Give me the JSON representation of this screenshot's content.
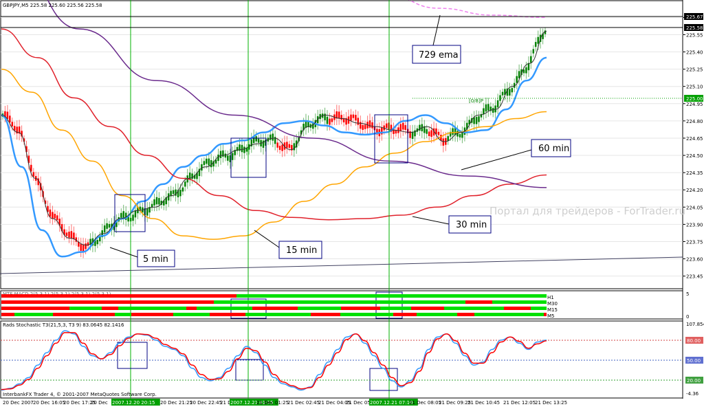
{
  "main": {
    "header": "GBPJPY,M5  225.58 225.60 225.56 225.58",
    "watermark": "Портал для трейдеров - ForTrader.ru",
    "price_ticks": [
      "225.70",
      "225.55",
      "225.40",
      "225.25",
      "225.10",
      "224.95",
      "224.80",
      "224.65",
      "224.50",
      "224.35",
      "224.20",
      "224.05",
      "223.90",
      "223.75",
      "223.60",
      "223.45"
    ],
    "tags": [
      "225.67",
      "225.58",
      "225.00"
    ],
    "level_label": "[0/8]P",
    "annotations": [
      "729 ema",
      "60 min",
      "30 min",
      "15 min",
      "5 min"
    ]
  },
  "mtf": {
    "header": "MTF MACD 2(5,3,1) 2(5,3,1) 2(5,3,1) 2(5,3,1)",
    "row_labels": [
      "H1",
      "M30",
      "M15",
      "M5"
    ],
    "scale_top": "5",
    "scale_bottom": "0"
  },
  "stoch": {
    "header": "Rads Stochastic T3(21,5,3, T3 9) 83.0645 82.1416",
    "levels": [
      "107.8544",
      "80.00",
      "50.00",
      "20.00",
      "-4.36"
    ]
  },
  "footer": "InterbankFX Trader 4, © 2001-2007 MetaQuotes Software Corp.",
  "time_axis": [
    "20 Dec 2007",
    "20 Dec 16:05",
    "20 Dec 17:25",
    "20 Dec",
    "2007.12.20 20:15",
    "20 Dec 21:25",
    "20 Dec 22:45",
    "21 Dec",
    "2007.12.21 01:15",
    "21 Dec 01:25",
    "21 Dec 02:45",
    "21 Dec 04:05",
    "21 Dec 05:..",
    "2007.12.21 07:10",
    "21 Dec 08:05",
    "21 Dec 09:25",
    "21 Dec 10:45",
    "21 Dec 12:05",
    "21 Dec 13:25"
  ],
  "colors": {
    "up": "#008000",
    "down": "#ff0000",
    "ema_blue": "#3399ff",
    "ema_orange": "#ffa500",
    "ema_red": "#e0202a",
    "ema_purple": "#6a2a8c",
    "ema729": "#ee82ee",
    "vlines": "#00b000",
    "box": "#000080"
  },
  "chart_data": [
    {
      "type": "line",
      "title": "GBPJPY,M5",
      "ylim": [
        223.4,
        225.75
      ],
      "x_start": "20 Dec 2007",
      "x_end": "21 Dec 13:25",
      "series": [
        {
          "name": "Price",
          "values": [
            224.85,
            224.7,
            224.3,
            223.95,
            223.78,
            223.72,
            223.82,
            223.95,
            224.02,
            224.05,
            224.15,
            224.3,
            224.4,
            224.5,
            224.55,
            224.6,
            224.65,
            224.55,
            224.75,
            224.85,
            224.82,
            224.78,
            224.75,
            224.72,
            224.7,
            224.75,
            224.62,
            224.7,
            224.85,
            224.9,
            225.1,
            225.3,
            225.58
          ]
        },
        {
          "name": "5 min",
          "values": [
            224.85,
            224.4,
            223.85,
            223.62,
            223.66,
            223.8,
            223.95,
            224.1,
            224.25,
            224.4,
            224.5,
            224.6,
            224.63,
            224.7,
            224.78,
            224.8,
            224.76,
            224.7,
            224.68,
            224.7,
            224.8,
            224.85,
            224.78,
            224.7,
            224.72,
            224.9,
            225.15,
            225.35
          ]
        },
        {
          "name": "15 min",
          "values": [
            225.25,
            225.05,
            224.72,
            224.45,
            224.15,
            223.95,
            223.8,
            223.77,
            223.8,
            223.92,
            224.1,
            224.25,
            224.4,
            224.52,
            224.62,
            224.7,
            224.75,
            224.82,
            224.88
          ]
        },
        {
          "name": "30 min",
          "values": [
            225.6,
            225.35,
            225.0,
            224.75,
            224.5,
            224.3,
            224.15,
            224.02,
            223.96,
            223.94,
            223.95,
            223.98,
            224.05,
            224.15,
            224.25,
            224.33
          ]
        },
        {
          "name": "60 min",
          "values": [
            226.4,
            225.6,
            225.15,
            224.85,
            224.65,
            224.45,
            224.32,
            224.22
          ]
        },
        {
          "name": "729 ema",
          "values": [
            225.9,
            225.78,
            225.72,
            225.7
          ]
        }
      ]
    },
    {
      "type": "line",
      "title": "Rads Stochastic T3(21,5,3, T3 9)",
      "ylim": [
        -4.36,
        107.8544
      ],
      "x_start": "20 Dec 2007",
      "x_end": "21 Dec 13:25",
      "series": [
        {
          "name": "Stochastic",
          "values": [
            5,
            8,
            15,
            25,
            45,
            65,
            85,
            100,
            95,
            75,
            60,
            55,
            65,
            80,
            90,
            95,
            93,
            85,
            75,
            70,
            60,
            40,
            25,
            20,
            25,
            40,
            60,
            75,
            65,
            45,
            25,
            15,
            10,
            5,
            10,
            30,
            50,
            70,
            90,
            95,
            80,
            60,
            40,
            20,
            10,
            20,
            40,
            70,
            90,
            95,
            80,
            60,
            45,
            50,
            70,
            85,
            90,
            80,
            70,
            82,
            85
          ]
        },
        {
          "name": "Signal",
          "values": [
            6,
            7,
            13,
            22,
            40,
            60,
            80,
            97,
            97,
            80,
            63,
            55,
            62,
            76,
            88,
            95,
            94,
            88,
            78,
            72,
            63,
            45,
            30,
            22,
            23,
            35,
            55,
            72,
            68,
            50,
            30,
            18,
            12,
            7,
            9,
            25,
            45,
            65,
            86,
            95,
            84,
            65,
            45,
            25,
            12,
            17,
            35,
            65,
            87,
            95,
            84,
            64,
            48,
            48,
            65,
            82,
            90,
            83,
            72,
            79,
            84
          ]
        }
      ]
    }
  ]
}
